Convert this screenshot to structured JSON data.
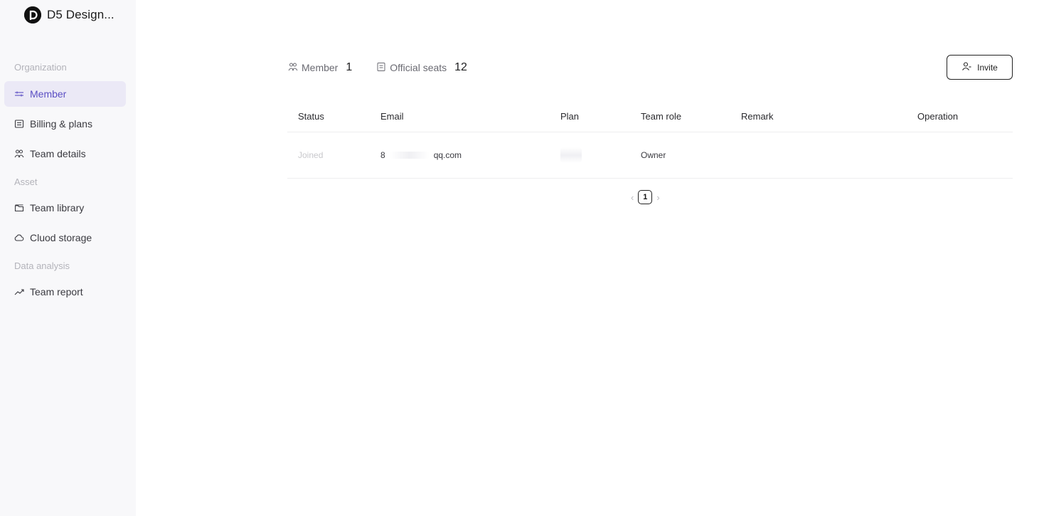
{
  "brand": {
    "name": "D5 Design...",
    "logo_letter": "D"
  },
  "sidebar": {
    "sections": [
      {
        "title": "Organization"
      },
      {
        "title": "Asset"
      },
      {
        "title": "Data analysis"
      }
    ],
    "items": [
      {
        "label": "Member",
        "icon": "sliders-icon",
        "active": true
      },
      {
        "label": "Billing & plans",
        "icon": "receipt-icon"
      },
      {
        "label": "Team details",
        "icon": "team-icon"
      },
      {
        "label": "Team library",
        "icon": "folder-icon"
      },
      {
        "label": "Cluod storage",
        "icon": "cloud-icon"
      },
      {
        "label": "Team report",
        "icon": "trend-icon"
      }
    ]
  },
  "stats": {
    "member_label": "Member",
    "member_count": "1",
    "seats_label": "Official seats",
    "seats_count": "12"
  },
  "invite": {
    "label": "Invite"
  },
  "table": {
    "headers": [
      "Status",
      "Email",
      "Plan",
      "Team role",
      "Remark",
      "Operation"
    ],
    "rows": [
      {
        "status": "Joined",
        "email_prefix": "8",
        "email_suffix": "qq.com",
        "plan": "",
        "team_role": "Owner",
        "remark": "",
        "operation": ""
      }
    ]
  },
  "pagination": {
    "current_page": "1",
    "prev": "‹",
    "next": "›"
  },
  "colors": {
    "accent": "#5b4fc4",
    "active_bg": "#ebe9f6",
    "sidebar_bg": "#f8f8fa"
  }
}
